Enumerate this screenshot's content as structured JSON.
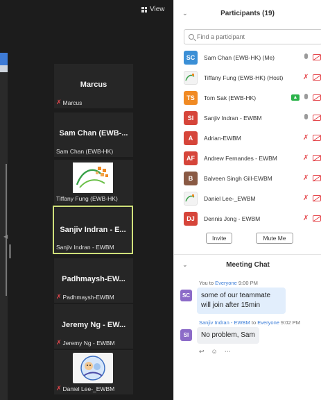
{
  "video": {
    "view_label": "View",
    "tiles": [
      {
        "title": "Marcus",
        "label": "Marcus",
        "muted": true,
        "type": "name"
      },
      {
        "title": "Sam Chan (EWB-...",
        "label": "Sam Chan (EWB-HK)",
        "muted": false,
        "type": "name"
      },
      {
        "title": "",
        "label": "Tiffany Fung (EWB-HK)",
        "muted": false,
        "type": "image"
      },
      {
        "title": "Sanjiv Indran - E...",
        "label": "Sanjiv Indran - EWBM",
        "muted": false,
        "type": "name",
        "active": true
      },
      {
        "title": "Padhmaysh-EW...",
        "label": "Padhmaysh-EWBM",
        "muted": true,
        "type": "name"
      },
      {
        "title": "Jeremy Ng - EW...",
        "label": "Jeremy Ng - EWBM",
        "muted": true,
        "type": "name"
      },
      {
        "title": "",
        "label": "Daniel Lee-_EWBM",
        "muted": true,
        "type": "cartoon"
      }
    ]
  },
  "participants": {
    "title": "Participants (19)",
    "search_placeholder": "Find a participant",
    "rows": [
      {
        "initials": "SC",
        "avatar_color": "#3b8fd6",
        "name": "Sam Chan (EWB-HK) (Me)",
        "mic": "on",
        "cam": "off"
      },
      {
        "initials": "",
        "avatar_color": "",
        "name": "Tiffany Fung (EWB-HK) (Host)",
        "mic": "off",
        "cam": "off",
        "avatar_image": true
      },
      {
        "initials": "TS",
        "avatar_color": "#f08a24",
        "name": "Tom Sak (EWB-HK)",
        "mic": "on",
        "cam": "off",
        "sharing": true
      },
      {
        "initials": "SI",
        "avatar_color": "#d6453a",
        "name": "Sanjiv Indran - EWBM",
        "mic": "on",
        "cam": "off"
      },
      {
        "initials": "A",
        "avatar_color": "#d6453a",
        "name": "Adrian-EWBM",
        "mic": "off",
        "cam": "off"
      },
      {
        "initials": "AF",
        "avatar_color": "#d6453a",
        "name": "Andrew Fernandes - EWBM",
        "mic": "off",
        "cam": "off"
      },
      {
        "initials": "B",
        "avatar_color": "#8a5a44",
        "name": "Balveen Singh Gill-EWBM",
        "mic": "off",
        "cam": "off"
      },
      {
        "initials": "",
        "avatar_color": "",
        "name": "Daniel Lee-_EWBM",
        "mic": "off",
        "cam": "off",
        "avatar_image": true
      },
      {
        "initials": "DJ",
        "avatar_color": "#d6453a",
        "name": "Dennis Jong - EWBM",
        "mic": "off",
        "cam": "off"
      }
    ],
    "invite_label": "Invite",
    "mute_me_label": "Mute Me"
  },
  "chat": {
    "title": "Meeting Chat",
    "messages": [
      {
        "sender": "You",
        "to_word": "to",
        "recipient": "Everyone",
        "time": "9:00 PM",
        "initials": "SC",
        "text": "some of our teammate will join after 15min",
        "style": "blue"
      },
      {
        "sender": "Sanjiv Indran - EWBM",
        "to_word": "to",
        "recipient": "Everyone",
        "time": "9:02 PM",
        "initials": "SI",
        "text": "No problem, Sam",
        "style": "gray"
      }
    ]
  }
}
